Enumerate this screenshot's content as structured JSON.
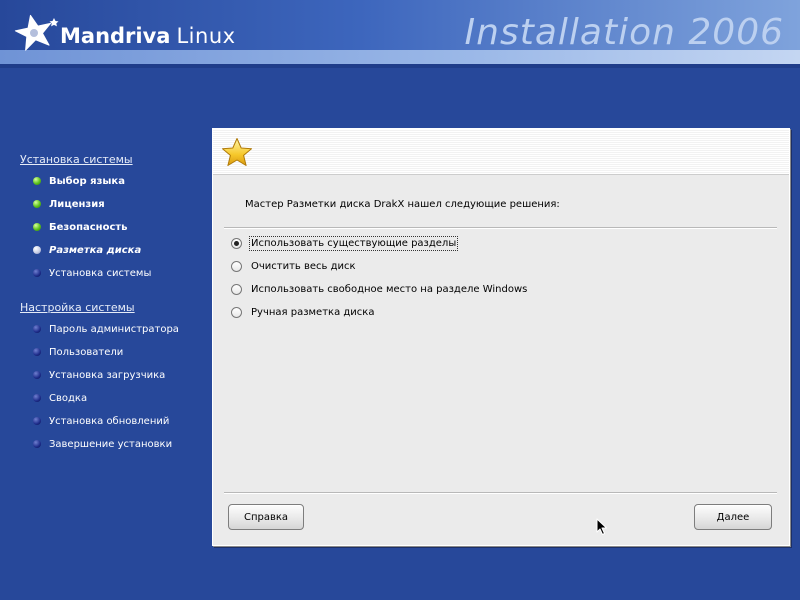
{
  "header": {
    "brand": "Mandriva",
    "product": "Linux",
    "title": "Installation 2006",
    "logo_icon": "mandriva-star-icon"
  },
  "sidebar": {
    "sections": [
      {
        "title": "Установка системы",
        "items": [
          {
            "label": "Выбор языка",
            "state": "done"
          },
          {
            "label": "Лицензия",
            "state": "done"
          },
          {
            "label": "Безопасность",
            "state": "done"
          },
          {
            "label": "Разметка диска",
            "state": "current"
          },
          {
            "label": "Установка системы",
            "state": "todo"
          }
        ]
      },
      {
        "title": "Настройка системы",
        "items": [
          {
            "label": "Пароль администратора",
            "state": "todo"
          },
          {
            "label": "Пользователи",
            "state": "todo"
          },
          {
            "label": "Установка загрузчика",
            "state": "todo"
          },
          {
            "label": "Сводка",
            "state": "todo"
          },
          {
            "label": "Установка обновлений",
            "state": "todo"
          },
          {
            "label": "Завершение установки",
            "state": "todo"
          }
        ]
      }
    ],
    "colors": {
      "done": "#5cc21c",
      "current": "#c9cfe6",
      "todo": "#1d2c8a"
    }
  },
  "dialog": {
    "banner_icon": "star-icon",
    "message": "Мастер Разметки диска DrakX нашел следующие решения:",
    "options": [
      {
        "label": "Использовать существующие разделы",
        "checked": true
      },
      {
        "label": "Очистить весь диск",
        "checked": false
      },
      {
        "label": "Использовать свободное место на разделе Windows",
        "checked": false
      },
      {
        "label": "Ручная разметка диска",
        "checked": false
      }
    ],
    "buttons": {
      "help": "Справка",
      "next": "Далее"
    }
  },
  "colors": {
    "background": "#27489a",
    "dialog": "#ebebeb"
  }
}
